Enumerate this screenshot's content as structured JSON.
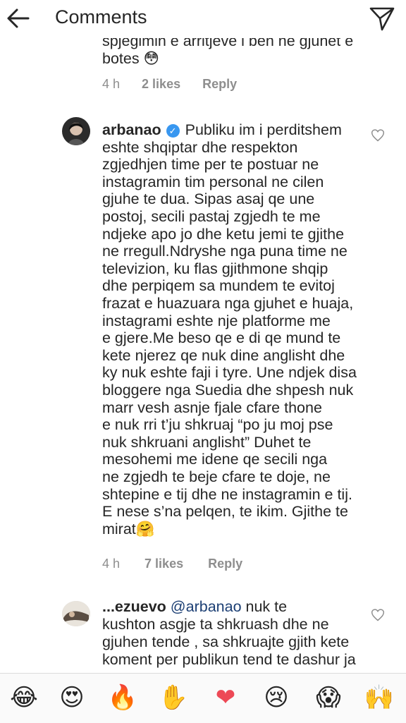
{
  "header": {
    "title": "Comments"
  },
  "comments": [
    {
      "lines": [
        "spjegimin e arritjeve i ben ne gjuhet e",
        "botes 😳"
      ],
      "time": "4 h",
      "likes": "2 likes",
      "reply": "Reply"
    },
    {
      "username": "arbanao",
      "verified": true,
      "lines": [
        "Publiku im i perditshem",
        "eshte shqiptar dhe respekton",
        "zgjedhjen time per te postuar ne",
        "instagramin tim personal ne cilen",
        "gjuhe te dua. Sipas asaj qe une",
        "postoj, secili pastaj zgjedh te me",
        "ndjeke apo jo dhe ketu jemi te gjithe",
        "ne rregull.Ndryshe nga puna time ne",
        "televizion, ku flas gjithmone shqip",
        "dhe perpiqem sa mundem te evitoj",
        "frazat e huazuara nga gjuhet e huaja,",
        "instagrami eshte nje platforme me",
        "e gjere.Me beso qe e di qe mund te",
        "kete njerez qe nuk dine anglisht dhe",
        "ky nuk eshte faji i tyre. Une ndjek disa",
        "bloggere nga Suedia dhe shpesh nuk",
        "marr vesh asnje fjale cfare thone",
        "e nuk rri t’ju shkruaj “po ju moj pse",
        "nuk shkruani anglisht” Duhet te",
        "mesohemi me idene qe secili nga",
        "ne zgjedh te beje cfare te doje, ne",
        "shtepine e tij dhe ne instagramin e tij.",
        "E nese s’na pelqen, te ikim. Gjithe te",
        "mirat🤗"
      ],
      "time": "4 h",
      "likes": "7 likes",
      "reply": "Reply"
    },
    {
      "username": "...ezuevo",
      "mention": "@arbanao",
      "lines": [
        "nuk te",
        "kushton asgje ta shkruash dhe ne",
        "gjuhen tende , sa shkruajte gjith kete",
        "koment per publikun tend te dashur ja"
      ]
    }
  ],
  "emoji_bar": [
    "😂",
    "😍",
    "🔥",
    "✋",
    "❤",
    "😢",
    "😱",
    "🙌"
  ],
  "colors": {
    "text": "#262626",
    "meta": "#8e8e8e",
    "verified": "#3897f0",
    "mention": "#1c3f74",
    "heart_red": "#ed4956"
  }
}
